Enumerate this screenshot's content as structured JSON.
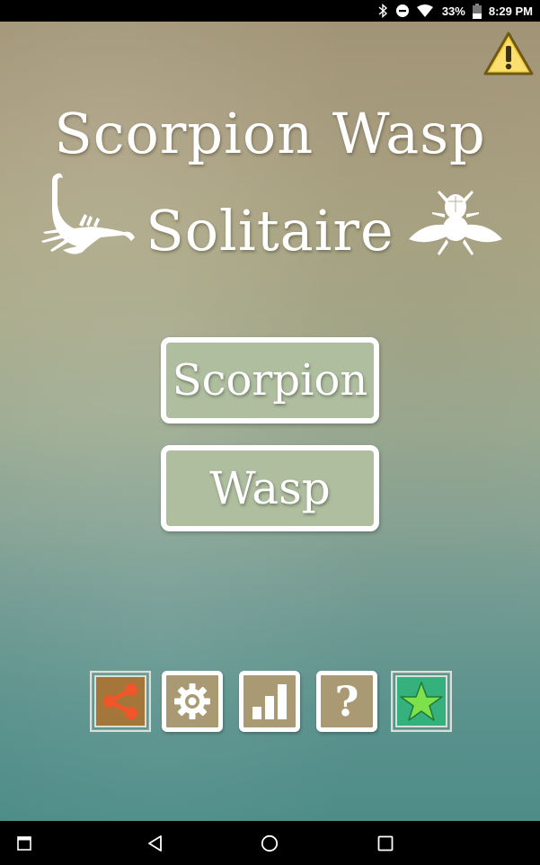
{
  "status_bar": {
    "icons": [
      "bluetooth-icon",
      "do-not-disturb-icon",
      "wifi-icon",
      "battery-icon"
    ],
    "battery_percent": "33%",
    "time": "8:29 PM"
  },
  "app": {
    "title_line1": "Scorpion Wasp",
    "title_line2": "Solitaire",
    "warning_icon": "warning-icon",
    "decorations": [
      "scorpion-icon",
      "wasp-icon"
    ],
    "mode_buttons": [
      {
        "label": "Scorpion"
      },
      {
        "label": "Wasp"
      }
    ],
    "toolbar": [
      {
        "name": "share",
        "icon": "share-icon",
        "color": "#f0562a"
      },
      {
        "name": "settings",
        "icon": "gear-icon",
        "color": "#ffffff"
      },
      {
        "name": "statistics",
        "icon": "bar-chart-icon",
        "color": "#ffffff"
      },
      {
        "name": "help",
        "icon": "question-icon",
        "label": "?"
      },
      {
        "name": "rate",
        "icon": "star-icon",
        "color": "#7ee04a"
      }
    ]
  },
  "nav_bar": {
    "buttons": [
      "recent-apps-window-icon",
      "back-icon",
      "home-icon",
      "overview-icon"
    ]
  }
}
